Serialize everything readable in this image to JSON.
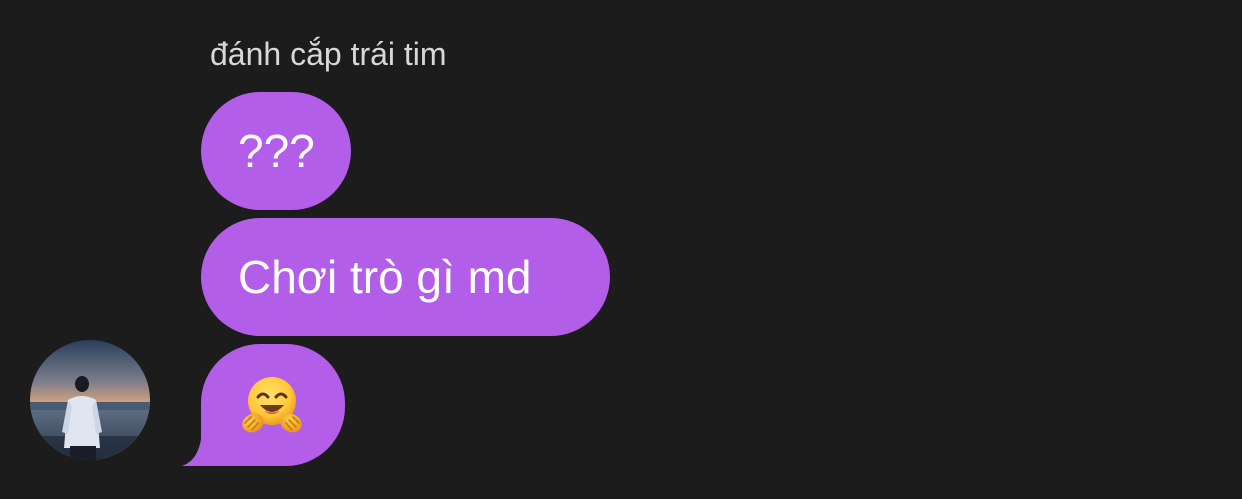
{
  "chat": {
    "sender_name": "đánh cắp trái tim",
    "messages": [
      {
        "text": "???"
      },
      {
        "text": "Chơi trò gì md"
      },
      {
        "emoji": "hugging-face-emoji"
      }
    ]
  },
  "colors": {
    "background": "#1c1c1d",
    "bubble": "#b25ee8",
    "bubble_text": "#ffffff",
    "sender_name": "#d8d8d8"
  },
  "avatar": {
    "icon": "profile-photo"
  }
}
